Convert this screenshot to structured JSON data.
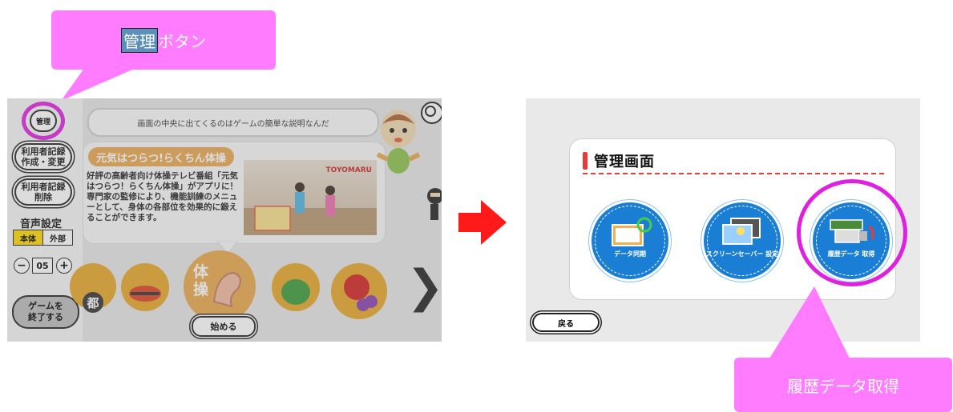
{
  "callouts": {
    "admin_prefix": "管理",
    "admin_suffix": "ボタン",
    "history": "履歴データ取得"
  },
  "left_screen": {
    "admin_button": "管理",
    "user_record_create": "利用者記録 作成・変更",
    "user_record_delete": "利用者記録 削除",
    "sound_settings": "音声設定",
    "sound_main": "本体",
    "sound_external": "外部",
    "volume": "05",
    "end_game": "ゲームを 終了する",
    "speech": "画面の中央に出てくるのはゲームの簡単な説明なんだ",
    "card_title": "元気はつらつ!らくちん体操",
    "card_description": "好評の高齢者向け体操テレビ番組「元気はつらつ！らくちん体操」がアプリに！専門家の監修により、機能訓練のメニューとして、身体の各部位を効果的に鍛えることができます。",
    "video_brand": "TOYOMARU",
    "category_city": "都",
    "category_exercise": "体操",
    "start_button": "始める"
  },
  "right_screen": {
    "admin_title": "管理画面",
    "menu": [
      {
        "label": "データ同期",
        "icon": "data-sync-icon"
      },
      {
        "label": "スクリーンセーバー 設定",
        "icon": "screensaver-icon"
      },
      {
        "label": "履歴データ 取得",
        "icon": "usb-download-icon"
      }
    ],
    "back_button": "戻る"
  },
  "colors": {
    "callout": "#ff7bff",
    "highlight_ring": "#e020e0",
    "arrow": "#ff1a1a",
    "menu_blue": "#1a7fd4",
    "accent_red": "#e53b3b"
  }
}
